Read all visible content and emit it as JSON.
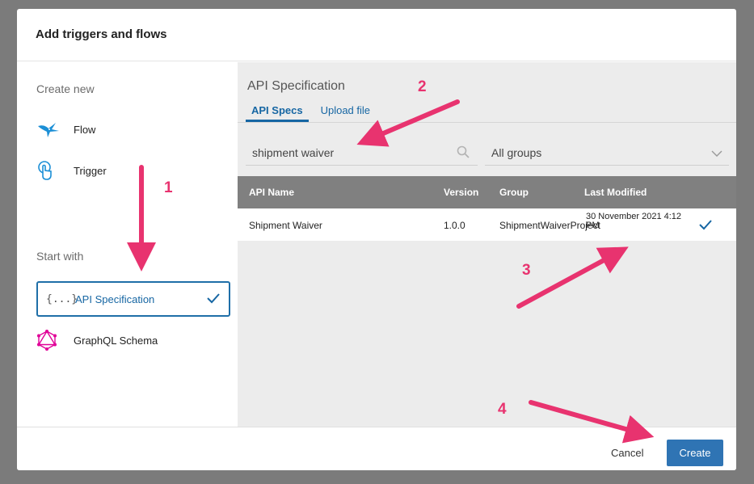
{
  "dialog": {
    "title": "Add triggers and flows"
  },
  "left": {
    "create_new_label": "Create new",
    "create_items": [
      {
        "label": "Flow",
        "icon": "hummingbird-icon"
      },
      {
        "label": "Trigger",
        "icon": "tap-hand-icon"
      }
    ],
    "start_with_label": "Start with",
    "start_items": [
      {
        "label": "API Specification",
        "icon": "curly-braces-icon",
        "icon_text": "{...}",
        "selected": true
      },
      {
        "label": "GraphQL Schema",
        "icon": "graphql-icon",
        "selected": false
      }
    ]
  },
  "right": {
    "title": "API Specification",
    "tabs": [
      {
        "label": "API Specs",
        "active": true
      },
      {
        "label": "Upload file",
        "active": false
      }
    ],
    "search": {
      "value": "shipment waiver"
    },
    "group_select": {
      "value": "All groups"
    },
    "table": {
      "columns": [
        "API Name",
        "Version",
        "Group",
        "Last Modified"
      ],
      "rows": [
        {
          "name": "Shipment Waiver",
          "version": "1.0.0",
          "group": "ShipmentWaiverProject",
          "modified_line1": "30 November 2021 4:12",
          "modified_line2": "PM",
          "selected": true
        }
      ]
    }
  },
  "footer": {
    "cancel_label": "Cancel",
    "create_label": "Create"
  },
  "annotations": {
    "steps": [
      "1",
      "2",
      "3",
      "4"
    ]
  },
  "colors": {
    "accent": "#1666a3",
    "primary_button": "#2f74b4",
    "annotation": "#e8336f",
    "table_header": "#808080"
  }
}
